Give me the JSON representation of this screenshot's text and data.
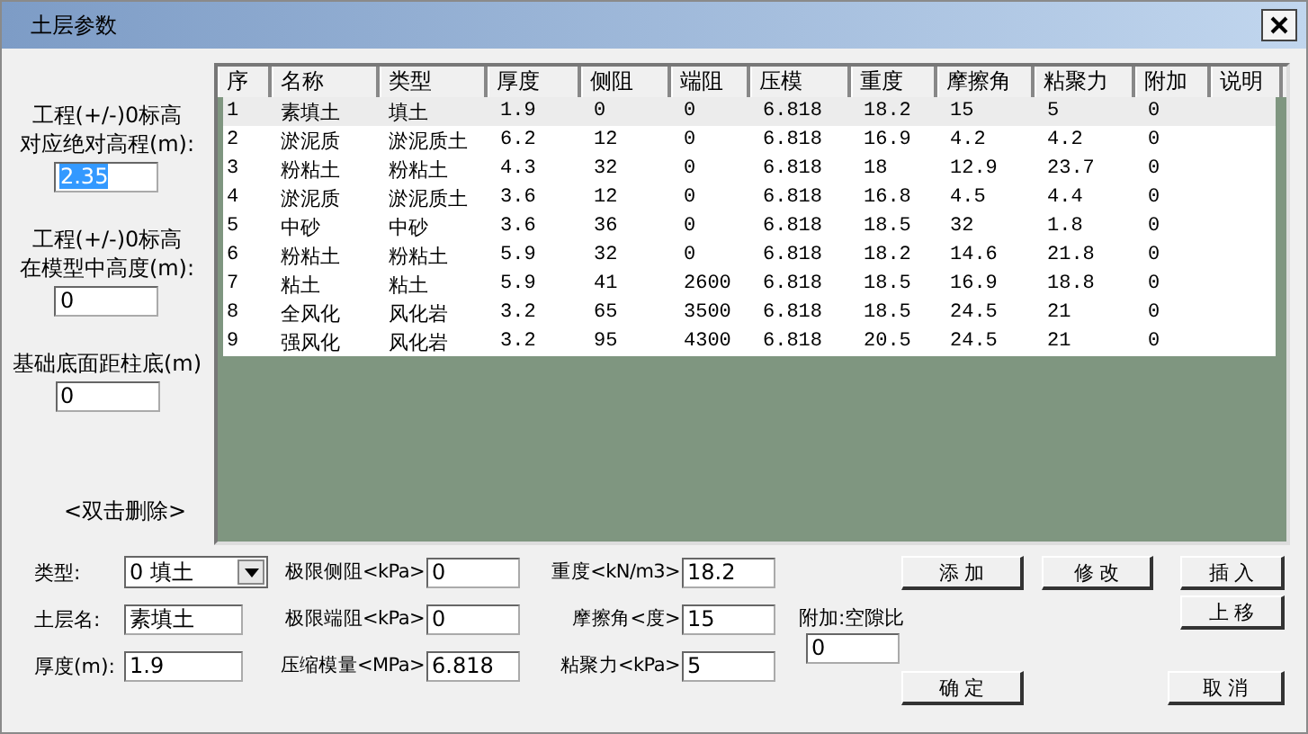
{
  "window": {
    "title": "土层参数"
  },
  "left_panel": {
    "fields": [
      {
        "label_lines": [
          "工程(+/-)0标高",
          "对应绝对高程(m):"
        ],
        "value": "2.35",
        "text_selected": true
      },
      {
        "label_lines": [
          "工程(+/-)0标高",
          "在模型中高度(m):"
        ],
        "value": "0",
        "text_selected": false
      },
      {
        "label_lines": [
          "基础底面距柱底(m)"
        ],
        "value": "0",
        "text_selected": false
      }
    ],
    "hint": "<双击删除>"
  },
  "table": {
    "columns": [
      "序",
      "名称",
      "类型",
      "厚度",
      "侧阻",
      "端阻",
      "压模",
      "重度",
      "摩擦角",
      "粘聚力",
      "附加",
      "说明"
    ],
    "rows": [
      {
        "selected": true,
        "cells": [
          "1",
          "素填土",
          "填土",
          "1.9",
          "0",
          "0",
          "6.818",
          "18.2",
          "15",
          "5",
          "0"
        ]
      },
      {
        "selected": false,
        "cells": [
          "2",
          "淤泥质",
          "淤泥质土",
          "6.2",
          "12",
          "0",
          "6.818",
          "16.9",
          "4.2",
          "4.2",
          "0"
        ]
      },
      {
        "selected": false,
        "cells": [
          "3",
          "粉粘土",
          "粉粘土",
          "4.3",
          "32",
          "0",
          "6.818",
          "18",
          "12.9",
          "23.7",
          "0"
        ]
      },
      {
        "selected": false,
        "cells": [
          "4",
          "淤泥质",
          "淤泥质土",
          "3.6",
          "12",
          "0",
          "6.818",
          "16.8",
          "4.5",
          "4.4",
          "0"
        ]
      },
      {
        "selected": false,
        "cells": [
          "5",
          "中砂",
          "中砂",
          "3.6",
          "36",
          "0",
          "6.818",
          "18.5",
          "32",
          "1.8",
          "0"
        ]
      },
      {
        "selected": false,
        "cells": [
          "6",
          "粉粘土",
          "粉粘土",
          "5.9",
          "32",
          "0",
          "6.818",
          "18.2",
          "14.6",
          "21.8",
          "0"
        ]
      },
      {
        "selected": false,
        "cells": [
          "7",
          "粘土",
          "粘土",
          "5.9",
          "41",
          "2600",
          "6.818",
          "18.5",
          "16.9",
          "18.8",
          "0"
        ]
      },
      {
        "selected": false,
        "cells": [
          "8",
          "全风化",
          "风化岩",
          "3.2",
          "65",
          "3500",
          "6.818",
          "18.5",
          "24.5",
          "21",
          "0"
        ]
      },
      {
        "selected": false,
        "cells": [
          "9",
          "强风化",
          "风化岩",
          "3.2",
          "95",
          "4300",
          "6.818",
          "20.5",
          "24.5",
          "21",
          "0"
        ]
      }
    ]
  },
  "form": {
    "type": {
      "label": "类型:",
      "value": "0 填土"
    },
    "name": {
      "label": "土层名:",
      "value": "素填土"
    },
    "thickness": {
      "label": "厚度(m):",
      "value": "1.9"
    },
    "side_resistance": {
      "label": "极限侧阻<kPa>",
      "value": "0"
    },
    "end_resistance": {
      "label": "极限端阻<kPa>",
      "value": "0"
    },
    "modulus": {
      "label": "压缩模量<MPa>",
      "value": "6.818"
    },
    "unit_weight": {
      "label": "重度<kN/m3>",
      "value": "18.2"
    },
    "friction_angle": {
      "label": "摩擦角<度>",
      "value": "15"
    },
    "cohesion": {
      "label": "粘聚力<kPa>",
      "value": "5"
    },
    "extra": {
      "label": "附加:空隙比",
      "value": "0"
    }
  },
  "buttons": {
    "add": "添 加",
    "modify": "修 改",
    "insert": "插 入",
    "move_up": "上 移",
    "ok": "确 定",
    "cancel": "取 消"
  }
}
